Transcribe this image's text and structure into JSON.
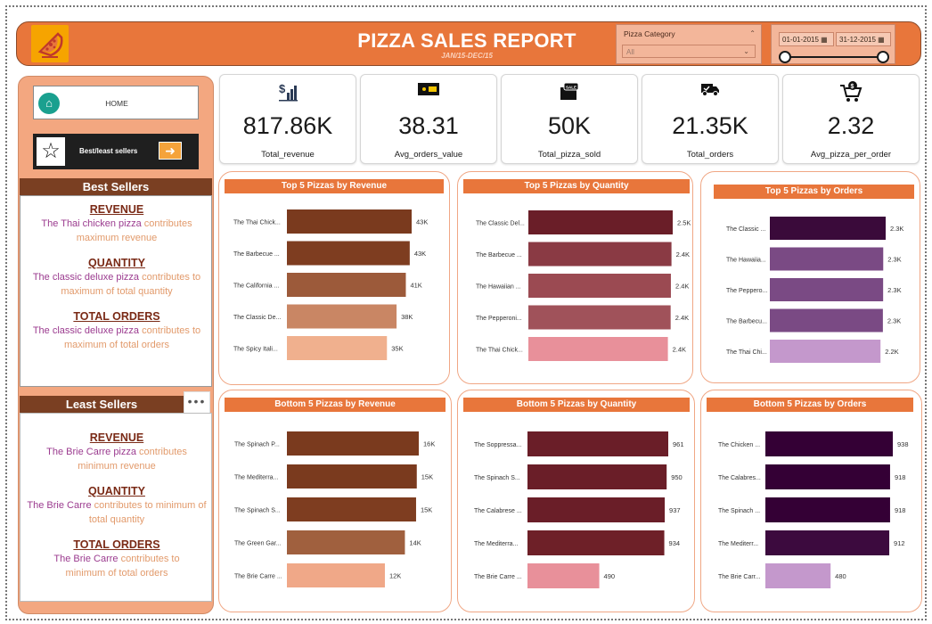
{
  "header": {
    "title": "PIZZA SALES REPORT",
    "subtitle": "JAN/15-DEC/15",
    "category_label": "Pizza Category",
    "category_value": "All",
    "date_start": "01-01-2015",
    "date_end": "31-12-2015"
  },
  "nav": {
    "home_label": "HOME",
    "best_label": "Best/least sellers"
  },
  "best_sellers": {
    "heading": "Best Sellers",
    "revenue": {
      "title": "REVENUE",
      "hl": "The Thai chicken pizza",
      "rest": " contributes maximum revenue"
    },
    "quantity": {
      "title": "QUANTITY",
      "hl": "The classic deluxe pizza",
      "rest": " contributes to maximum of total quantity"
    },
    "orders": {
      "title": "TOTAL ORDERS",
      "hl": "The classic deluxe pizza",
      "rest": " contributes to maximum of total orders"
    }
  },
  "least_sellers": {
    "heading": "Least Sellers",
    "revenue": {
      "title": "REVENUE",
      "hl": "The Brie Carre pizza",
      "rest": " contributes minimum revenue"
    },
    "quantity": {
      "title": "QUANTITY",
      "hl": "The Brie Carre",
      "rest": " contributes to minimum of total quantity"
    },
    "orders": {
      "title": "TOTAL ORDERS",
      "hl": "The Brie Carre",
      "rest": " contributes to minimum of total orders"
    }
  },
  "kpis": [
    {
      "value": "817.86K",
      "label": "Total_revenue",
      "icon": "revenue-chart-icon"
    },
    {
      "value": "38.31",
      "label": "Avg_orders_value",
      "icon": "money-icon"
    },
    {
      "value": "50K",
      "label": "Total_pizza_sold",
      "icon": "sales-box-icon"
    },
    {
      "value": "21.35K",
      "label": "Total_orders",
      "icon": "delivery-truck-icon"
    },
    {
      "value": "2.32",
      "label": "Avg_pizza_per_order",
      "icon": "shopping-cart-icon"
    }
  ],
  "chart_data": [
    {
      "type": "bar",
      "title": "Top 5 Pizzas by Revenue",
      "categories": [
        "The Thai Chick...",
        "The Barbecue ...",
        "The California ...",
        "The Classic De...",
        "The Spicy Itali..."
      ],
      "values": [
        43434,
        42768,
        41410,
        38180,
        34831
      ],
      "labels": [
        "43K",
        "43K",
        "41K",
        "38K",
        "35K"
      ],
      "colors": [
        "#7a3a1e",
        "#7e3d20",
        "#9c5a3a",
        "#c98664",
        "#f0b08e"
      ]
    },
    {
      "type": "bar",
      "title": "Top 5 Pizzas by Quantity",
      "categories": [
        "The Classic Del...",
        "The Barbecue ...",
        "The Hawaiian ...",
        "The Pepperoni...",
        "The Thai Chick..."
      ],
      "values": [
        2453,
        2432,
        2422,
        2418,
        2371
      ],
      "labels": [
        "2.5K",
        "2.4K",
        "2.4K",
        "2.4K",
        "2.4K"
      ],
      "colors": [
        "#6a1e28",
        "#8a3a44",
        "#9b4a52",
        "#a0525a",
        "#e8909a"
      ]
    },
    {
      "type": "bar",
      "title": "Top 5 Pizzas by Orders",
      "categories": [
        "The Classic ...",
        "The Hawaiia...",
        "The Peppero...",
        "The Barbecu...",
        "The Thai Chi..."
      ],
      "values": [
        2329,
        2280,
        2278,
        2273,
        2225
      ],
      "labels": [
        "2.3K",
        "2.3K",
        "2.3K",
        "2.3K",
        "2.2K"
      ],
      "colors": [
        "#3a0a3a",
        "#7a4a84",
        "#7a4a84",
        "#7a4a84",
        "#c498cc"
      ]
    },
    {
      "type": "bar",
      "title": "Bottom 5 Pizzas by Revenue",
      "categories": [
        "The Spinach P...",
        "The Mediterra...",
        "The Spinach S...",
        "The Green Gar...",
        "The Brie Carre ..."
      ],
      "values": [
        15596,
        15360,
        15277,
        13956,
        11588
      ],
      "labels": [
        "16K",
        "15K",
        "15K",
        "14K",
        "12K"
      ],
      "colors": [
        "#7a3a1e",
        "#7a3a1e",
        "#7e3d20",
        "#a0603e",
        "#f0a888"
      ]
    },
    {
      "type": "bar",
      "title": "Bottom 5 Pizzas by Quantity",
      "categories": [
        "The Soppressa...",
        "The Spinach S...",
        "The Calabrese ...",
        "The Mediterra...",
        "The Brie Carre ..."
      ],
      "values": [
        961,
        950,
        937,
        934,
        490
      ],
      "labels": [
        "961",
        "950",
        "937",
        "934",
        "490"
      ],
      "colors": [
        "#6a1e28",
        "#6a1e28",
        "#6a1e28",
        "#6e2028",
        "#e8909a"
      ]
    },
    {
      "type": "bar",
      "title": "Bottom 5 Pizzas by Orders",
      "categories": [
        "The Chicken ...",
        "The Calabres...",
        "The Spinach ...",
        "The Mediterr...",
        "The Brie Carr..."
      ],
      "values": [
        938,
        918,
        918,
        912,
        480
      ],
      "labels": [
        "938",
        "918",
        "918",
        "912",
        "480"
      ],
      "colors": [
        "#340035",
        "#340035",
        "#340035",
        "#3c0a3e",
        "#c498cc"
      ]
    }
  ]
}
